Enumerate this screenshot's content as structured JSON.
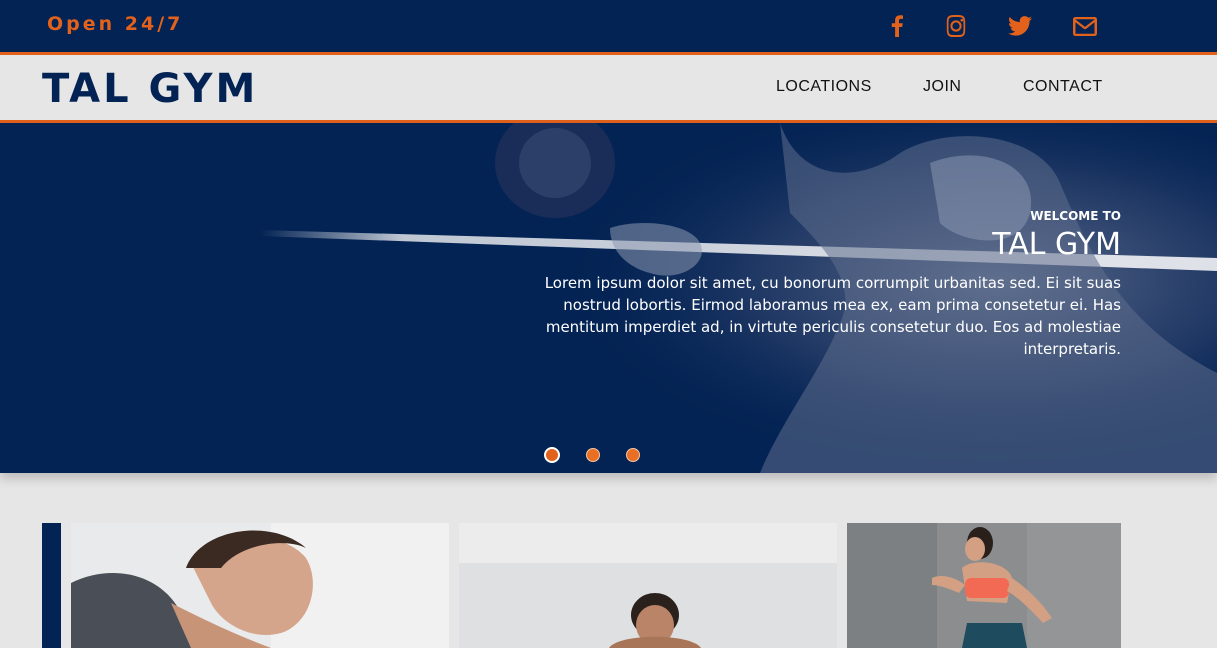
{
  "topbar": {
    "open_hours": "Open 24/7",
    "social": [
      {
        "icon": "facebook-icon"
      },
      {
        "icon": "instagram-icon"
      },
      {
        "icon": "twitter-icon"
      },
      {
        "icon": "mail-icon"
      }
    ]
  },
  "nav": {
    "brand": "TAL GYM",
    "links": [
      "LOCATIONS",
      "JOIN",
      "CONTACT"
    ]
  },
  "hero": {
    "welcome": "WELCOME TO",
    "title": "TAL GYM",
    "body": "Lorem ipsum dolor sit amet, cu bonorum corrumpit urbanitas sed. Ei sit suas nostrud lobortis. Eirmod laboramus mea ex, eam prima consetetur ei. Has mentitum imperdiet ad, in virtute periculis consetetur duo. Eos ad molestiae interpretaris.",
    "slides": 3,
    "active_slide": 1
  },
  "cards": [
    {
      "image": "woman-workout-photo"
    },
    {
      "image": "man-pushup-photo"
    },
    {
      "image": "woman-running-photo"
    }
  ],
  "colors": {
    "navy": "#032354",
    "orange": "#e2621c",
    "light_gray": "#e6e6e6"
  }
}
